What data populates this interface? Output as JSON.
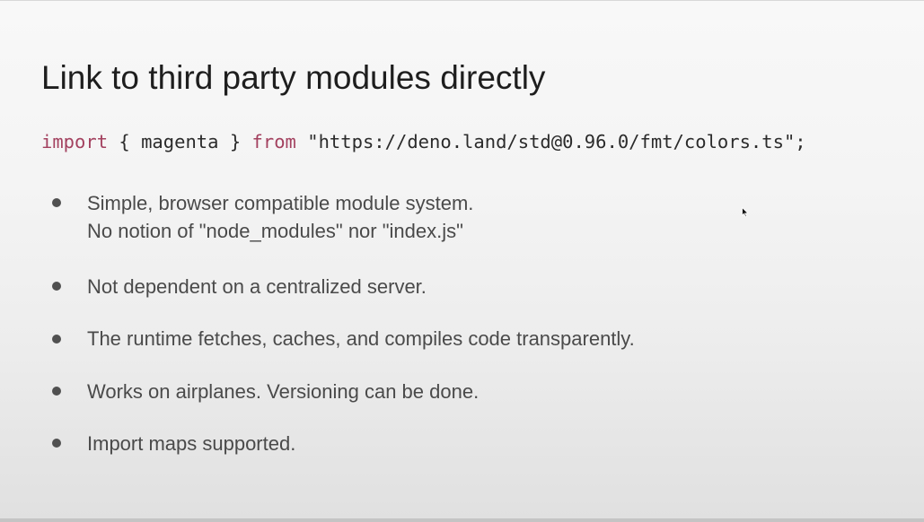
{
  "slide": {
    "title": "Link to third party modules directly",
    "code": {
      "keyword_import": "import",
      "braces_open": " { ",
      "identifier": "magenta",
      "braces_close": " } ",
      "keyword_from": "from",
      "space": " ",
      "module_url": "\"https://deno.land/std@0.96.0/fmt/colors.ts\";"
    },
    "bullets": [
      {
        "line1": "Simple, browser compatible module system.",
        "line2": "No notion of \"node_modules\" nor \"index.js\""
      },
      {
        "line1": "Not dependent on a centralized server."
      },
      {
        "line1": "The runtime fetches, caches, and compiles code transparently."
      },
      {
        "line1": "Works on airplanes. Versioning can be done."
      },
      {
        "line1": "Import maps supported."
      }
    ],
    "colors": {
      "keyword": "#a3415f",
      "title_text": "#1e1e1e",
      "bullet_text": "#4a4a4a",
      "background": "#f4f4f4"
    },
    "cursor_icon": "mouse-pointer-icon"
  }
}
